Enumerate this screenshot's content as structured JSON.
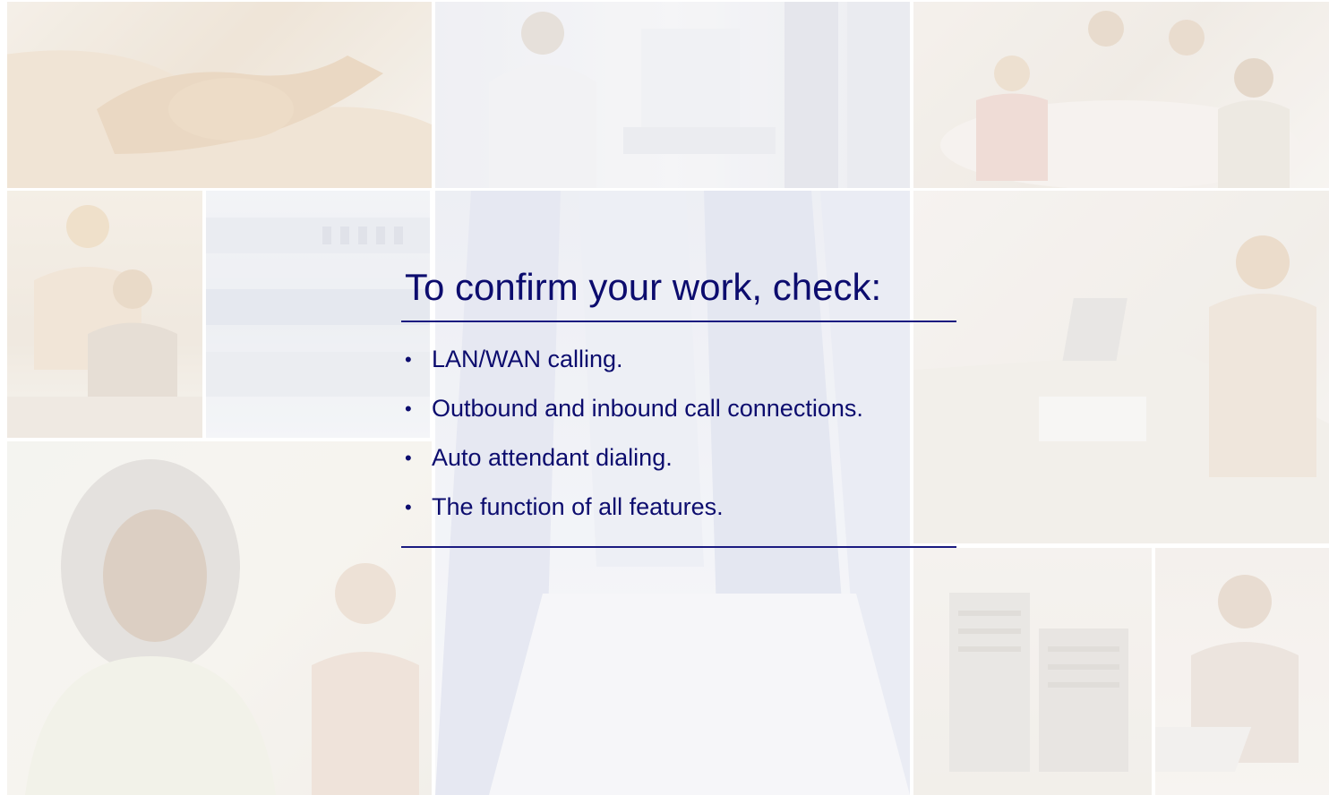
{
  "slide": {
    "title": "To confirm your work, check:",
    "bullet_glyph": "•",
    "bullets": [
      "LAN/WAN calling.",
      "Outbound and inbound call connections.",
      "Auto attendant dialing.",
      "The function of all features."
    ]
  },
  "colors": {
    "text": "#0c0c6e",
    "rule": "#1a1a80",
    "background": "#ffffff"
  },
  "background_photos": [
    "handshake-photo",
    "engineer-at-computer-photo",
    "business-meeting-photo",
    "colleagues-at-desk-photo",
    "network-equipment-photo",
    "data-center-aisle-photo",
    "woman-at-laptop-photo",
    "smiling-woman-photo",
    "server-racks-photo",
    "woman-with-laptop-photo"
  ]
}
